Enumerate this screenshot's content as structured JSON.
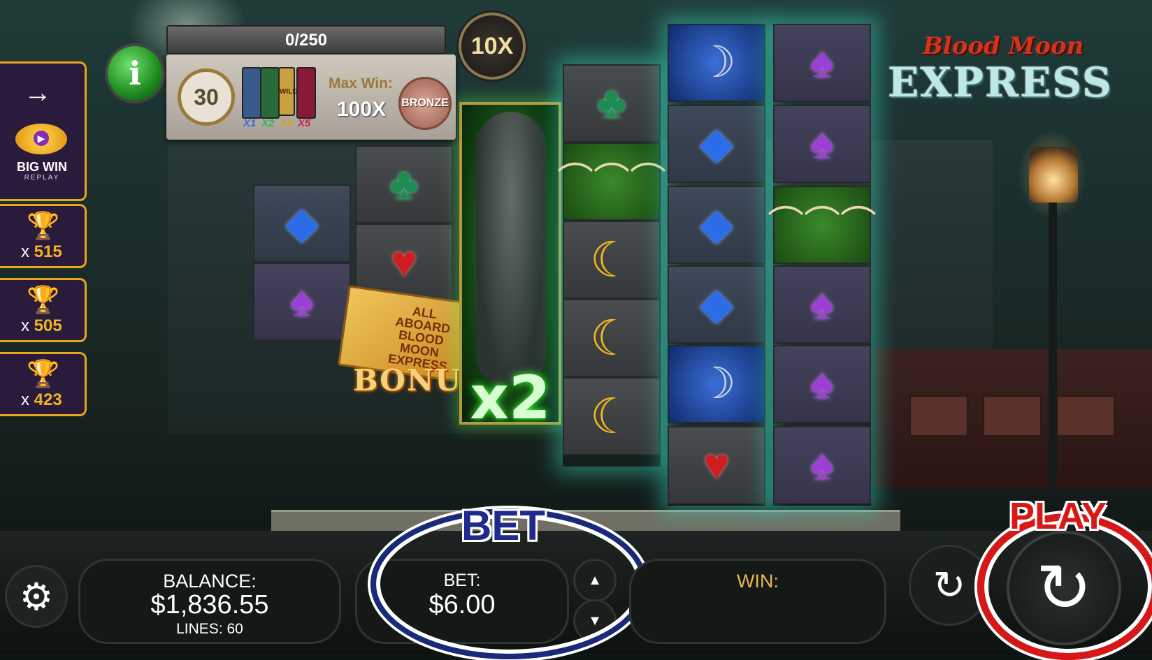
{
  "game": {
    "logo_top": "Blood Moon",
    "logo_bottom": "EXPRESS"
  },
  "progress": {
    "text": "0/250",
    "multiplier": "10X"
  },
  "info": {
    "button_label": "i",
    "spins": "30",
    "card_multipliers": [
      "X1",
      "X2",
      "X3",
      "X5"
    ],
    "card_wild_label": "WILD",
    "max_win_label": "Max Win:",
    "max_win_value": "100X",
    "tier_badge": "BRONZE"
  },
  "sidebar": {
    "arrow": "→",
    "bigwin_title": "BIG WIN",
    "bigwin_sub": "REPLAY",
    "trophies": [
      {
        "color": "#d4a520",
        "x": "x",
        "count": "515"
      },
      {
        "color": "#b8bcc4",
        "x": "x",
        "count": "505"
      },
      {
        "color": "#c08a30",
        "x": "x",
        "count": "423"
      }
    ]
  },
  "reels": {
    "wolf_multiplier": "x2",
    "bonus_label": "BONUS",
    "ticket_text": "ALL ABOARD BLOOD MOON EXPRESS",
    "symbols": {
      "reel1": [
        "diamond",
        "spade"
      ],
      "reel2": [
        "club",
        "heart"
      ],
      "reel4": [
        "club",
        "claws",
        "moon",
        "moon",
        "moon"
      ],
      "reel5": [
        "scythe",
        "diamond",
        "diamond",
        "diamond",
        "scythe",
        "heart"
      ],
      "reel6": [
        "spade",
        "spade",
        "claws",
        "spade",
        "spade",
        "spade"
      ]
    }
  },
  "bottom": {
    "balance_label": "BALANCE:",
    "balance_value": "$1,836.55",
    "lines": "LINES: 60",
    "bet_label": "BET:",
    "bet_value": "$6.00",
    "bet_title": "BET",
    "win_label": "WIN:",
    "play_title": "PLAY"
  }
}
